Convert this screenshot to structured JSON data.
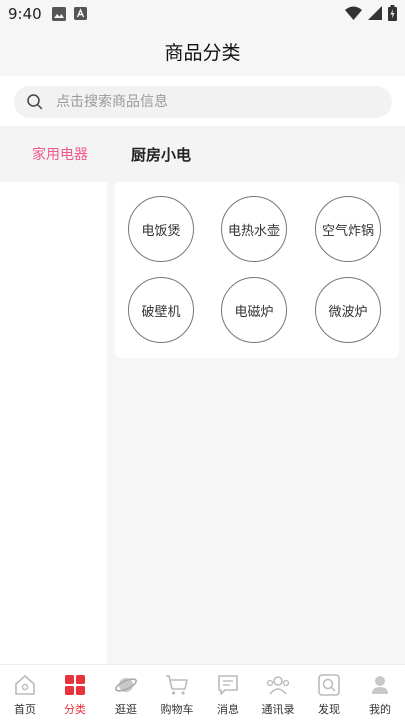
{
  "status_bar": {
    "time": "9:40"
  },
  "header": {
    "title": "商品分类"
  },
  "search": {
    "placeholder": "点击搜索商品信息"
  },
  "top_tabs": [
    {
      "label": "家用电器",
      "active": true
    },
    {
      "label": "厨房小电",
      "active": false
    }
  ],
  "categories": [
    {
      "label": "电饭煲"
    },
    {
      "label": "电热水壶"
    },
    {
      "label": "空气炸锅"
    },
    {
      "label": "破壁机"
    },
    {
      "label": "电磁炉"
    },
    {
      "label": "微波炉"
    }
  ],
  "bottom_nav": [
    {
      "label": "首页",
      "icon": "home-icon"
    },
    {
      "label": "分类",
      "icon": "category-icon",
      "active": true
    },
    {
      "label": "逛逛",
      "icon": "planet-icon"
    },
    {
      "label": "购物车",
      "icon": "cart-icon"
    },
    {
      "label": "消息",
      "icon": "message-icon"
    },
    {
      "label": "通讯录",
      "icon": "contacts-icon"
    },
    {
      "label": "发现",
      "icon": "discover-icon"
    },
    {
      "label": "我的",
      "icon": "profile-icon"
    }
  ],
  "colors": {
    "accent": "#f05a8a",
    "nav_active": "#e8333c",
    "background": "#f6f6f6"
  }
}
